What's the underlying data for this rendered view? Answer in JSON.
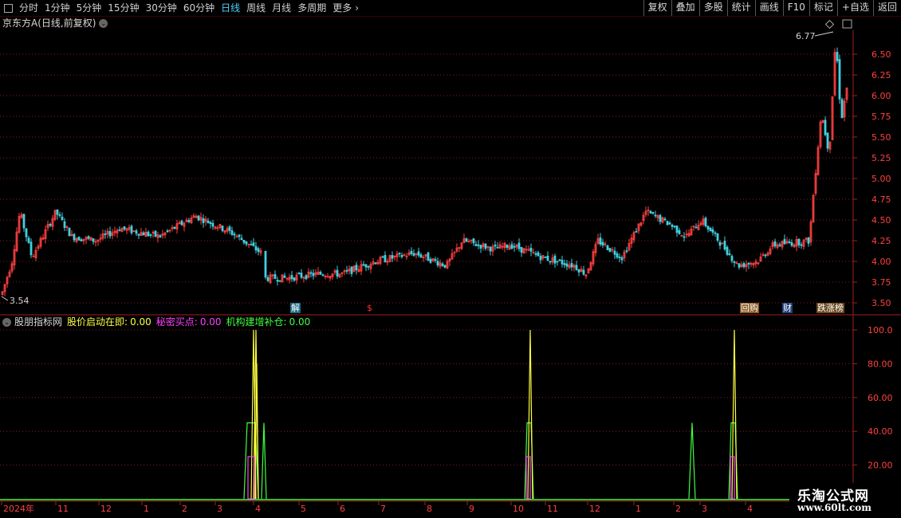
{
  "toolbar": {
    "periods": [
      "分时",
      "1分钟",
      "5分钟",
      "15分钟",
      "30分钟",
      "60分钟",
      "日线",
      "周线",
      "月线",
      "多周期",
      "更多"
    ],
    "active_period": "日线",
    "more_arrow": "›",
    "buttons": [
      "复权",
      "叠加",
      "多股",
      "统计",
      "画线",
      "F10",
      "标记",
      "+自选",
      "返回"
    ]
  },
  "main_chart": {
    "stock_name": "京东方A",
    "period_label": "(日线,前复权)",
    "y_ticks": [
      "6.50",
      "6.25",
      "6.00",
      "5.75",
      "5.50",
      "5.25",
      "5.00",
      "4.75",
      "4.50",
      "4.25",
      "4.00",
      "3.75",
      "3.50"
    ],
    "y_tick_values": [
      6.5,
      6.25,
      6.0,
      5.75,
      5.5,
      5.25,
      5.0,
      4.75,
      4.5,
      4.25,
      4.0,
      3.75,
      3.5
    ],
    "high_label": "6.77",
    "low_label": "3.54",
    "price_range": [
      3.45,
      6.9
    ],
    "badges": [
      {
        "text": "解",
        "color": "#ffffff",
        "bg": "#1a6a80"
      },
      {
        "text": "$",
        "color": "#ff3030",
        "bg": "#000000"
      },
      {
        "text": "回购",
        "color": "#ffffff",
        "bg": "#8a5a20"
      },
      {
        "text": "财",
        "color": "#ffffff",
        "bg": "#204080"
      },
      {
        "text": "跌涨榜",
        "color": "#ffffff",
        "bg": "#6a4a20"
      }
    ]
  },
  "indicator": {
    "name": "股朋指标网",
    "line1_label": "股价启动在即:",
    "line1_value": "0.00",
    "line1_color": "#ffff40",
    "line2_label": "秘密买点:",
    "line2_value": "0.00",
    "line2_color": "#ff40ff",
    "line3_label": "机构建增补仓:",
    "line3_value": "0.00",
    "line3_color": "#40ff40",
    "y_ticks": [
      "100.0",
      "80.00",
      "60.00",
      "40.00",
      "20.00"
    ],
    "y_tick_values": [
      100,
      80,
      60,
      40,
      20
    ]
  },
  "x_axis": {
    "labels": [
      "2024年",
      "11",
      "12",
      "1",
      "2",
      "3",
      "4",
      "5",
      "6",
      "7",
      "8",
      "9",
      "10",
      "11",
      "12",
      "1",
      "2",
      "3",
      "4"
    ]
  },
  "watermark": {
    "line1": "乐淘公式网",
    "line2": "www.60lt.com"
  },
  "colors": {
    "up": "#ff4040",
    "down": "#40d0e0",
    "grid": "#802020",
    "axis_text": "#ff4040"
  }
}
